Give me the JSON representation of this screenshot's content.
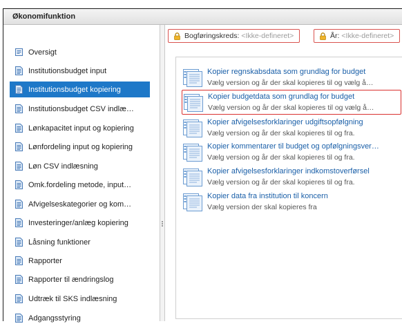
{
  "window": {
    "title": "Økonomifunktion"
  },
  "sidebar": {
    "items": [
      {
        "label": "Oversigt",
        "icon": "overview-icon",
        "active": false
      },
      {
        "label": "Institutionsbudget input",
        "icon": "document-icon",
        "active": false
      },
      {
        "label": "Institutionsbudget kopiering",
        "icon": "document-icon",
        "active": true
      },
      {
        "label": "Institutionsbudget CSV indlæ…",
        "icon": "document-icon",
        "active": false
      },
      {
        "label": "Lønkapacitet input og kopiering",
        "icon": "document-icon",
        "active": false
      },
      {
        "label": "Lønfordeling input og kopiering",
        "icon": "document-icon",
        "active": false
      },
      {
        "label": "Løn CSV indlæsning",
        "icon": "document-icon",
        "active": false
      },
      {
        "label": "Omk.fordeling metode, input…",
        "icon": "document-icon",
        "active": false
      },
      {
        "label": "Afvigelseskategorier og kom…",
        "icon": "document-icon",
        "active": false
      },
      {
        "label": "Investeringer/anlæg kopiering",
        "icon": "document-icon",
        "active": false
      },
      {
        "label": "Låsning funktioner",
        "icon": "document-icon",
        "active": false
      },
      {
        "label": "Rapporter",
        "icon": "document-icon",
        "active": false
      },
      {
        "label": "Rapporter til ændringslog",
        "icon": "document-icon",
        "active": false
      },
      {
        "label": "Udtræk til SKS indlæsning",
        "icon": "document-icon",
        "active": false
      },
      {
        "label": "Adgangsstyring",
        "icon": "document-icon",
        "active": false
      }
    ]
  },
  "filters": {
    "bogforingskreds": {
      "label": "Bogføringskreds:",
      "value": "<Ikke-defineret>",
      "icon": "lock-icon"
    },
    "aar": {
      "label": "År:",
      "value": "<Ikke-defineret>",
      "icon": "lock-icon"
    }
  },
  "tasks": [
    {
      "title": "Kopier regnskabsdata som grundlag for budget",
      "desc": "Vælg version og år der skal kopieres til og vælg å…",
      "selected": false
    },
    {
      "title": "Kopier budgetdata som grundlag for budget",
      "desc": "Vælg version og år der skal kopieres til og vælg å…",
      "selected": true
    },
    {
      "title": "Kopier afvigelsesforklaringer udgiftsopfølgning",
      "desc": "Vælg version og år der skal kopieres til og fra.",
      "selected": false
    },
    {
      "title": "Kopier kommentarer til budget og opfølgningsver…",
      "desc": "Vælg version og år der skal kopieres til og fra.",
      "selected": false
    },
    {
      "title": "Kopier afvigelsesforklaringer indkomstoverførsel",
      "desc": "Vælg version og år der skal kopieres til og fra.",
      "selected": false
    },
    {
      "title": "Kopier data fra institution til koncern",
      "desc": "Vælg version der skal kopieres fra",
      "selected": false
    }
  ],
  "colors": {
    "accent": "#1e78c8",
    "highlight": "#d9302f",
    "link": "#1a5fa8"
  }
}
